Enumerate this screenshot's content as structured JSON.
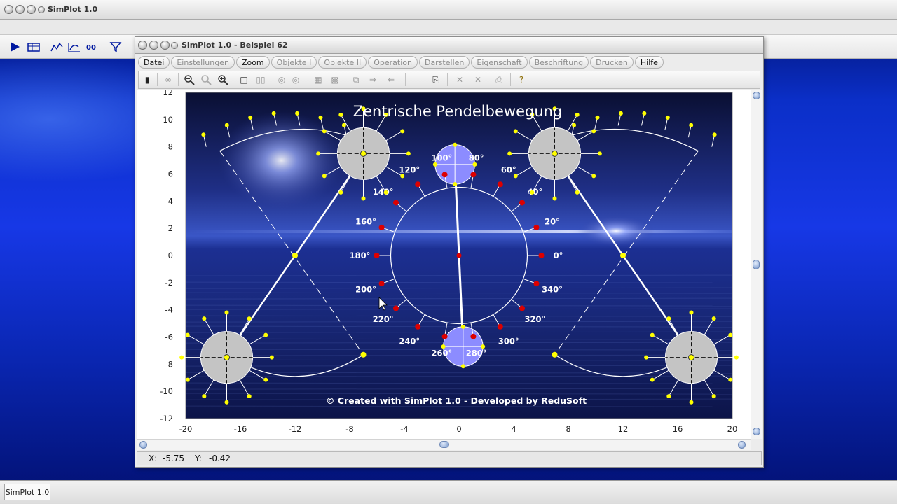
{
  "app": {
    "title": "SimPlot 1.0",
    "taskbar_label": "SimPlot 1.0"
  },
  "child_window": {
    "title": "SimPlot 1.0 - Beispiel 62",
    "menu": [
      {
        "label": "Datei",
        "active": true
      },
      {
        "label": "Einstellungen",
        "active": false
      },
      {
        "label": "Zoom",
        "active": true
      },
      {
        "label": "Objekte I",
        "active": false
      },
      {
        "label": "Objekte II",
        "active": false
      },
      {
        "label": "Operation",
        "active": false
      },
      {
        "label": "Darstellen",
        "active": false
      },
      {
        "label": "Eigenschaft",
        "active": false
      },
      {
        "label": "Beschriftung",
        "active": false
      },
      {
        "label": "Drucken",
        "active": false
      },
      {
        "label": "Hilfe",
        "active": true
      }
    ]
  },
  "status": {
    "x_label": "X:",
    "x_value": "-5.75",
    "y_label": "Y:",
    "y_value": "-0.42"
  },
  "plot": {
    "title": "Zentrische Pendelbewegung",
    "credit": "© Created with SimPlot 1.0 - Developed by ReduSoft",
    "x_ticks": [
      "-20",
      "-16",
      "-12",
      "-8",
      "-4",
      "0",
      "4",
      "8",
      "12",
      "16",
      "20"
    ],
    "y_ticks": [
      "12",
      "10",
      "8",
      "6",
      "4",
      "2",
      "0",
      "-2",
      "-4",
      "-6",
      "-8",
      "-10",
      "-12"
    ],
    "angle_labels": [
      "0°",
      "20°",
      "40°",
      "60°",
      "80°",
      "100°",
      "120°",
      "140°",
      "160°",
      "180°",
      "200°",
      "220°",
      "240°",
      "260°",
      "280°",
      "300°",
      "320°",
      "340°"
    ],
    "colors": {
      "accent_circle": "#8c8cff",
      "gear": "#c4c4c4",
      "point_yellow": "#ffff00",
      "point_red": "#dd0000"
    }
  }
}
